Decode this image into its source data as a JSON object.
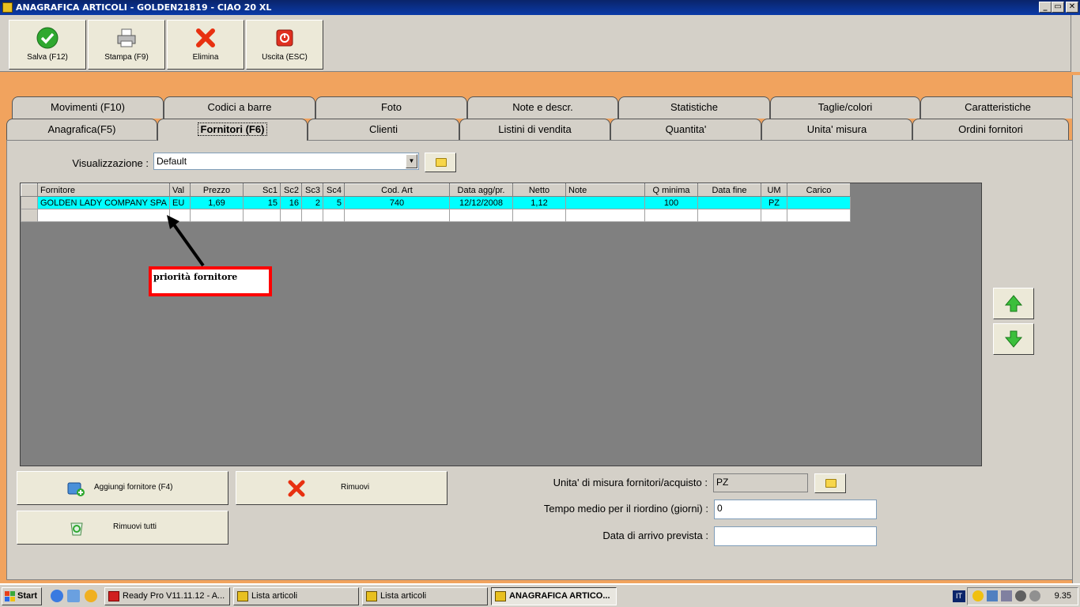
{
  "window": {
    "title": "ANAGRAFICA ARTICOLI - GOLDEN21819 - CIAO 20 XL",
    "controls": [
      "_",
      "▭",
      "✕"
    ]
  },
  "toolbar": {
    "save_label": "Salva (F12)",
    "print_label": "Stampa (F9)",
    "delete_label": "Elimina",
    "exit_label": "Uscita (ESC)"
  },
  "tabs_row1": [
    "Movimenti (F10)",
    "Codici a barre",
    "Foto",
    "Note e descr.",
    "Statistiche",
    "Taglie/colori",
    "Caratteristiche"
  ],
  "tabs_row2": [
    "Anagrafica(F5)",
    "Fornitori (F6)",
    "Clienti",
    "Listini di vendita",
    "Quantita'",
    "Unita' misura",
    "Ordini fornitori"
  ],
  "view": {
    "label": "Visualizzazione :",
    "value": "Default"
  },
  "grid": {
    "columns": [
      "Fornitore",
      "Val",
      "Prezzo",
      "Sc1",
      "Sc2",
      "Sc3",
      "Sc4",
      "Cod. Art",
      "Data agg/pr.",
      "Netto",
      "Note",
      "Q minima",
      "Data fine",
      "UM",
      "Carico"
    ],
    "rows": [
      [
        "GOLDEN LADY COMPANY SPA",
        "EU",
        "1,69",
        "15",
        "16",
        "2",
        "5",
        "740",
        "12/12/2008",
        "1,12",
        "",
        "100",
        "",
        "PZ",
        ""
      ]
    ]
  },
  "annotation": {
    "text": "priorità fornitore",
    "color": "#ff0000"
  },
  "buttons": {
    "add_supplier": "Aggiungi fornitore (F4)",
    "remove": "Rimuovi",
    "remove_all": "Rimuovi tutti"
  },
  "fields": {
    "um_label": "Unita' di misura fornitori/acquisto :",
    "um_value": "PZ",
    "reorder_label": "Tempo medio per il riordino (giorni) :",
    "reorder_value": "0",
    "arrival_label": "Data di arrivo prevista :",
    "arrival_value": ""
  },
  "taskbar": {
    "start": "Start",
    "items": [
      "Ready Pro V11.11.12 - A...",
      "Lista articoli",
      "Lista articoli",
      "ANAGRAFICA ARTICO..."
    ],
    "lang": "IT",
    "time": "9.35"
  },
  "colors": {
    "title_bar": "#0a246a",
    "selected_row": "#00ffff",
    "background": "#f1a35e"
  }
}
